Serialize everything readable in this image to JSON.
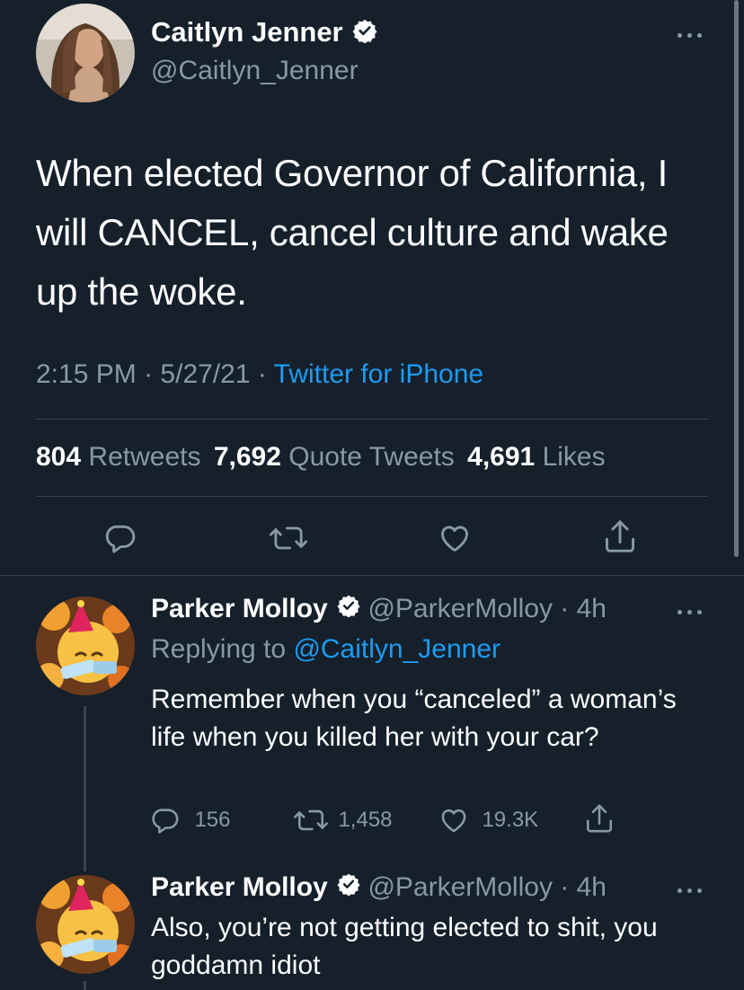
{
  "main_tweet": {
    "author_name": "Caitlyn Jenner",
    "author_handle": "@Caitlyn_Jenner",
    "text": "When elected Governor of California, I will CANCEL, cancel culture and wake up the woke.",
    "time": "2:15 PM",
    "sep1": "·",
    "date": "5/27/21",
    "sep2": "·",
    "source": "Twitter for iPhone",
    "stats": {
      "retweets_count": "804",
      "retweets_label": "Retweets",
      "quotes_count": "7,692",
      "quotes_label": "Quote Tweets",
      "likes_count": "4,691",
      "likes_label": "Likes"
    }
  },
  "replies": [
    {
      "author_name": "Parker Molloy",
      "handle_time": "@ParkerMolloy · 4h",
      "replying_prefix": "Replying to",
      "replying_to": "@Caitlyn_Jenner",
      "text": "Remember when you “canceled” a woman’s life when you killed her with your car?",
      "reply_count": "156",
      "retweet_count": "1,458",
      "like_count": "19.3K"
    },
    {
      "author_name": "Parker Molloy",
      "handle_time": "@ParkerMolloy · 4h",
      "text": "Also, you’re not getting elected to shit, you goddamn idiot"
    }
  ],
  "icons": [
    "verified-badge-icon",
    "more-icon",
    "reply-icon",
    "retweet-icon",
    "like-icon",
    "share-icon"
  ],
  "colors": {
    "background": "#15202b",
    "accent": "#1d9bf0",
    "muted": "#8899a6",
    "divider": "#38444d"
  }
}
